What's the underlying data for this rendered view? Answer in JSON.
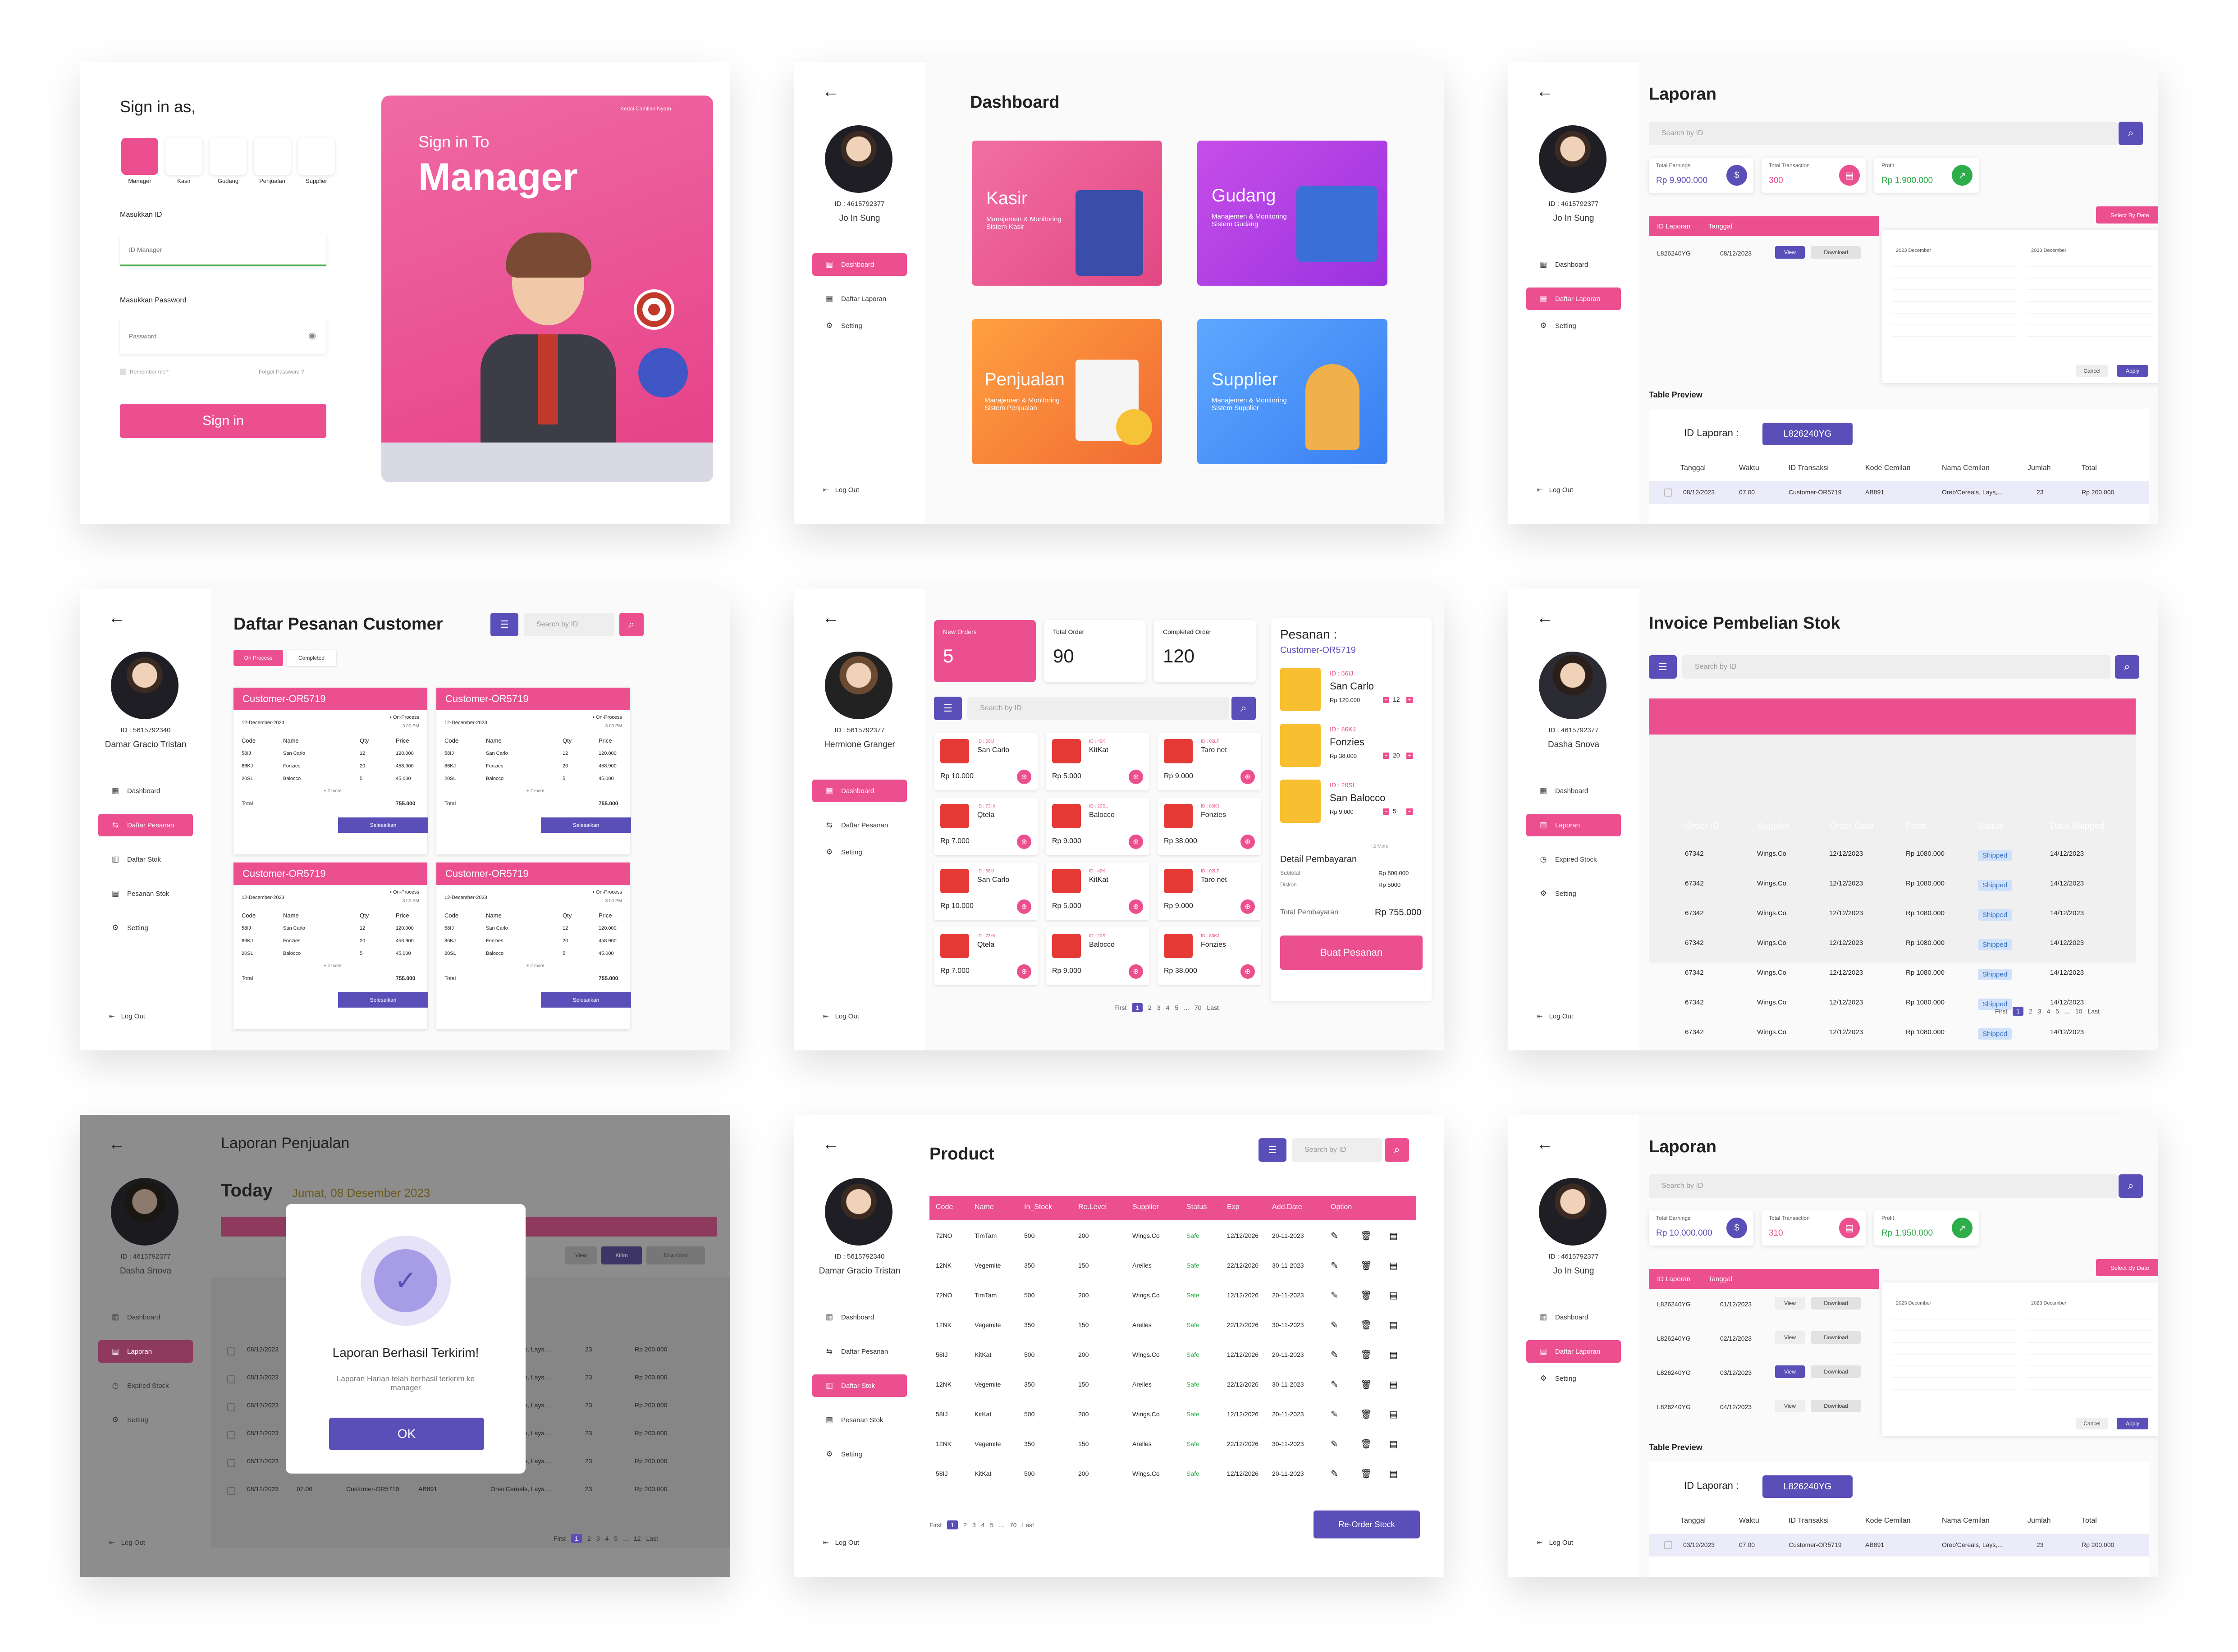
{
  "login": {
    "title": "Sign in as,",
    "roles": [
      "Manager",
      "Kasir",
      "Gudang",
      "Penjualan",
      "Supplier"
    ],
    "id_label": "Masukkan ID",
    "id_placeholder": "ID Manager",
    "pw_label": "Masukkan Password",
    "pw_placeholder": "Password",
    "remember": "Remember me?",
    "forgot": "Forgot Password ?",
    "button": "Sign in",
    "banner_small": "Sign in To",
    "banner_big": "Manager",
    "brand": "Kedai Camilan Nyam"
  },
  "dashboard": {
    "title": "Dashboard",
    "cards": [
      {
        "name": "Kasir",
        "desc": "Manajemen & Monitoring Sistem Kasir"
      },
      {
        "name": "Gudang",
        "desc": "Manajemen & Monitoring Sistem Gudang"
      },
      {
        "name": "Penjualan",
        "desc": "Manajemen & Monitoring Sistem Penjualan"
      },
      {
        "name": "Supplier",
        "desc": "Manajemen & Monitoring Sistem Supplier"
      }
    ],
    "nav": [
      "Dashboard",
      "Daftar Laporan",
      "Setting"
    ],
    "logout": "Log Out"
  },
  "users": {
    "manager_id": "ID : 4615792377",
    "manager_name": "Jo In Sung",
    "cashier_id": "ID : 5615792340",
    "cashier_name": "Damar Gracio Tristan",
    "sales_id": "ID : 5615792377",
    "sales_name": "Hermione Granger",
    "gudang_id": "ID : 4615792377",
    "gudang_name": "Dasha Snova"
  },
  "laporan": {
    "title": "Laporan",
    "search": "Search by ID",
    "stats": [
      {
        "label": "Total Earnings",
        "value": "Rp 9.900.000"
      },
      {
        "label": "Total Transaction",
        "value": "300"
      },
      {
        "label": "Profit",
        "value": "Rp 1.900.000"
      }
    ],
    "stats2": [
      {
        "label": "Total Earnings",
        "value": "Rp 10.000.000"
      },
      {
        "label": "Total Transaction",
        "value": "310"
      },
      {
        "label": "Profit",
        "value": "Rp 1.950.000"
      }
    ],
    "col_id": "ID Laporan",
    "col_date": "Tanggal",
    "rows": [
      {
        "id": "L826240YG",
        "date": "08/12/2023"
      }
    ],
    "rows2": [
      {
        "id": "L826240YG",
        "date": "01/12/2023"
      },
      {
        "id": "L826240YG",
        "date": "02/12/2023"
      },
      {
        "id": "L826240YG",
        "date": "03/12/2023"
      },
      {
        "id": "L826240YG",
        "date": "04/12/2023"
      }
    ],
    "view": "View",
    "download": "Download",
    "select_date": "Select By Date",
    "cal_left": "2023 December",
    "cal_right": "2023 December",
    "cancel": "Cancel",
    "apply": "Apply",
    "preview": "Table Preview",
    "id_laporan_label": "ID Laporan :",
    "id_laporan_value": "L826240YG",
    "cols": [
      "Tanggal",
      "Waktu",
      "ID Transaksi",
      "Kode Cemilan",
      "Nama Cemilan",
      "Jumlah",
      "Total"
    ],
    "prow": [
      "08/12/2023",
      "07.00",
      "Customer-OR5719",
      "AB891",
      "Oreo'Cereals, Lays,...",
      "23",
      "Rp 200.000"
    ],
    "prow2": [
      "03/12/2023",
      "07.00",
      "Customer-OR5719",
      "AB891",
      "Oreo'Cereals, Lays,...",
      "23",
      "Rp 200.000"
    ],
    "nav": [
      "Dashboard",
      "Daftar Laporan",
      "Setting"
    ]
  },
  "pesanan": {
    "title": "Daftar Pesanan Customer",
    "search": "Search by ID",
    "tabs": [
      "On Process",
      "Completed"
    ],
    "card_title": "Customer-OR5719",
    "date": "12-December-2023",
    "status": "• On-Process",
    "time": "3.00 PM",
    "cols": [
      "Code",
      "Name",
      "Qty",
      "Price"
    ],
    "items": [
      [
        "58IJ",
        "San Carlo",
        "12",
        "120.000"
      ],
      [
        "86KJ",
        "Fonzies",
        "20",
        "458.900"
      ],
      [
        "20SL",
        "Balocco",
        "5",
        "45.000"
      ]
    ],
    "more": "+ 2 more",
    "total_label": "Total",
    "total": "755.000",
    "button": "Selesaikan",
    "nav": [
      "Dashboard",
      "Daftar Pesanan",
      "Daftar Stok",
      "Pesanan Stok",
      "Setting"
    ]
  },
  "kasir": {
    "stats": [
      {
        "label": "New Orders",
        "value": "5"
      },
      {
        "label": "Total Order",
        "value": "90"
      },
      {
        "label": "Completed Order",
        "value": "120"
      }
    ],
    "search": "Search by ID",
    "products": [
      {
        "id": "ID : 56IJ",
        "name": "San Carlo",
        "price": "Rp 10.000"
      },
      {
        "id": "ID : 49KI",
        "name": "KitKat",
        "price": "Rp 5.000"
      },
      {
        "id": "ID : 02LF",
        "name": "Taro net",
        "price": "Rp 9.000"
      },
      {
        "id": "ID : 73HI",
        "name": "Qtela",
        "price": "Rp 7.000"
      },
      {
        "id": "ID : 20SL",
        "name": "Balocco",
        "price": "Rp 9.000"
      },
      {
        "id": "ID : 86KJ",
        "name": "Fonzies",
        "price": "Rp 38.000"
      }
    ],
    "order_title": "Pesanan :",
    "order_customer": "Customer-OR5719",
    "order_items": [
      {
        "id": "ID : 56IJ",
        "name": "San Carlo",
        "price": "Rp 120.000",
        "qty": "12"
      },
      {
        "id": "ID : 86KJ",
        "name": "Fonzies",
        "price": "Rp 38.000",
        "qty": "20"
      },
      {
        "id": "ID : 20SL",
        "name": "San Balocco",
        "price": "Rp 9.000",
        "qty": "5"
      }
    ],
    "more": "+2 More",
    "detail": "Detail Pembayaran",
    "subtotal_label": "Subtotal",
    "subtotal": "Rp 800.000",
    "diskon_label": "Diskon",
    "diskon": "Rp 5000",
    "total_label": "Total Pembayaran",
    "total": "Rp 755.000",
    "button": "Buat Pesanan",
    "nav": [
      "Dashboard",
      "Daftar Pesanan",
      "Setting"
    ]
  },
  "invoice": {
    "title": "Invoice Pembelian Stok",
    "search": "Search by ID",
    "cols": [
      "Order ID",
      "Supplier",
      "Order Date",
      "Price",
      "Status",
      "Data Shipped"
    ],
    "row": [
      "67342",
      "Wings.Co",
      "12/12/2023",
      "Rp 1080.000",
      "Shipped",
      "14/12/2023"
    ],
    "nav": [
      "Dashboard",
      "Laporan",
      "Expired Stock",
      "Setting"
    ]
  },
  "penjualan": {
    "title": "Laporan Penjualan",
    "today": "Today",
    "today_date": "Jumat, 08 Desember 2023",
    "modal_title": "Laporan Berhasil Terkirim!",
    "modal_text": "Laporan Harian telah berhasil terkirim ke manager",
    "modal_ok": "OK",
    "kirim": "Kirim",
    "rows": [
      "08/12/2023",
      "07.00",
      "Customer-OR5719",
      "AB891",
      "Oreo'Cereals, Lays,...",
      "23",
      "Rp 200.000"
    ]
  },
  "product": {
    "title": "Product",
    "search": "Search by ID",
    "cols": [
      "Code",
      "Name",
      "In_Stock",
      "Re.Level",
      "Supplier",
      "Status",
      "Exp",
      "Add.Date",
      "Option"
    ],
    "rows": [
      [
        "72NO",
        "TimTam",
        "500",
        "200",
        "Wings.Co",
        "Safe",
        "12/12/2026",
        "20-11-2023"
      ],
      [
        "12NK",
        "Vegemite",
        "350",
        "150",
        "Arelles",
        "Safe",
        "22/12/2026",
        "30-11-2023"
      ],
      [
        "72NO",
        "TimTam",
        "500",
        "200",
        "Wings.Co",
        "Safe",
        "12/12/2026",
        "20-11-2023"
      ],
      [
        "12NK",
        "Vegemite",
        "350",
        "150",
        "Arelles",
        "Safe",
        "22/12/2026",
        "30-11-2023"
      ],
      [
        "58IJ",
        "KitKat",
        "500",
        "200",
        "Wings.Co",
        "Safe",
        "12/12/2026",
        "20-11-2023"
      ],
      [
        "12NK",
        "Vegemite",
        "350",
        "150",
        "Arelles",
        "Safe",
        "22/12/2026",
        "30-11-2023"
      ],
      [
        "58IJ",
        "KitKat",
        "500",
        "200",
        "Wings.Co",
        "Safe",
        "12/12/2026",
        "20-11-2023"
      ],
      [
        "12NK",
        "Vegemite",
        "350",
        "150",
        "Arelles",
        "Safe",
        "22/12/2026",
        "30-11-2023"
      ],
      [
        "58IJ",
        "KitKat",
        "500",
        "200",
        "Wings.Co",
        "Safe",
        "12/12/2026",
        "20-11-2023"
      ]
    ],
    "button": "Re-Order Stock"
  },
  "pager": {
    "first": "First",
    "pages": [
      "1",
      "2",
      "3",
      "4",
      "5",
      "..."
    ],
    "last_num": "70",
    "last": "Last",
    "inv_last": "10",
    "pen_last": "12"
  },
  "colors": {
    "pink": "#ec4f8f",
    "purple": "#5a4fb8",
    "bg": "#fafafa"
  }
}
